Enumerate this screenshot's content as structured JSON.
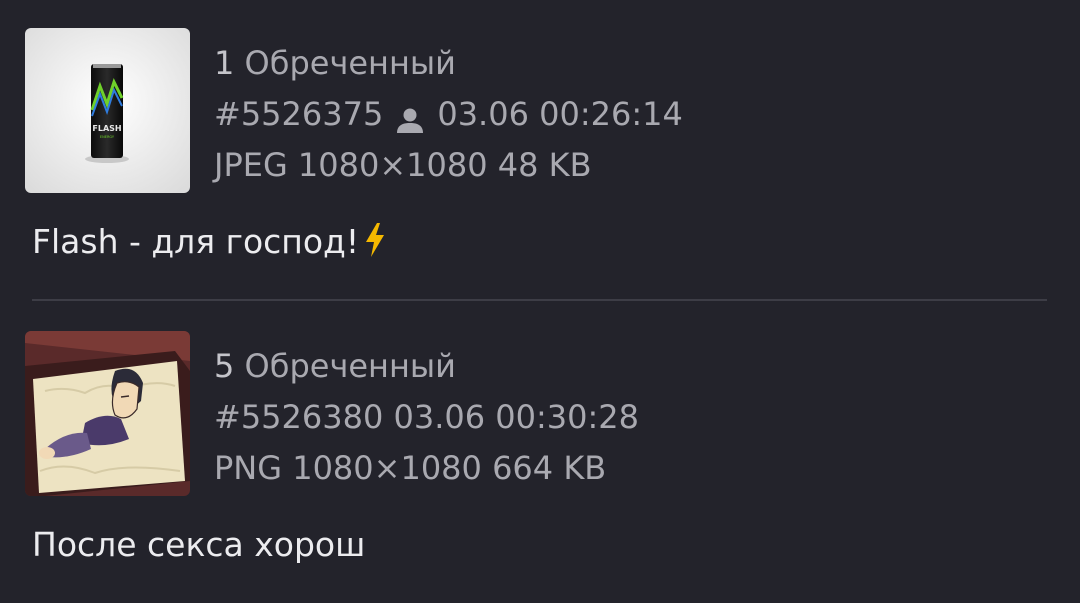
{
  "posts": [
    {
      "number": "1",
      "author": "Обреченный",
      "id": "#5526375",
      "datetime": "03.06 00:26:14",
      "file": "JPEG 1080×1080 48 KB",
      "comment": "Flash - для господ!",
      "show_user_icon": true,
      "thumbnail": "energy-drink-can"
    },
    {
      "number": "5",
      "author": "Обреченный",
      "id": "#5526380",
      "datetime": "03.06 00:30:28",
      "file": "PNG 1080×1080 664 KB",
      "comment": "После секса хорош",
      "show_user_icon": false,
      "thumbnail": "cartoon-man-in-coffin"
    }
  ],
  "colors": {
    "background": "#23232b",
    "meta_text": "#a9a9b0",
    "comment_text": "#ececef",
    "divider": "#3d3d46",
    "bolt": "#f5b800"
  }
}
